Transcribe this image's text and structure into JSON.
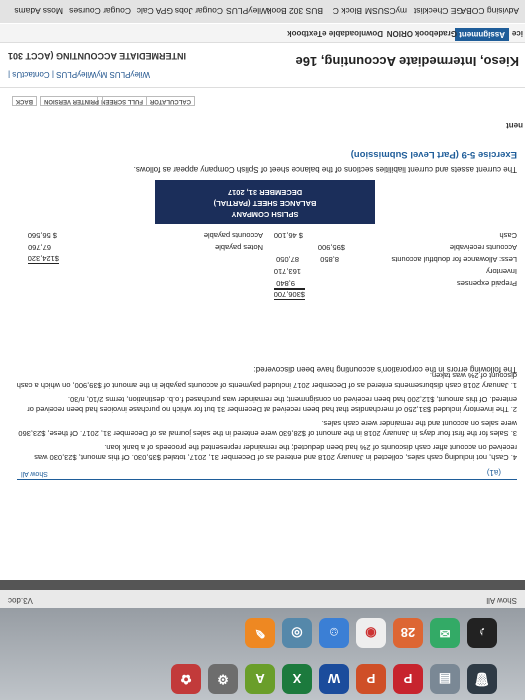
{
  "bookmarks": [
    "Advising COBA",
    "GE Checklist",
    "myCSUSM",
    "Block C",
    "BUS 302 Book",
    "WileyPLUS",
    "Cougar Jobs",
    "GPA Calc",
    "Cougar Courses",
    "Moss Adams"
  ],
  "header": {
    "course_title": "Kieso, Intermediate Accounting, 16e",
    "wp_links": "WileyPLUS  MyWileyPLUS | ContactUs |",
    "course_name": "INTERMEDIATE ACCOUNTING (ACCT 301",
    "tabs": [
      "ice",
      "Assignment",
      "Gradebook",
      "ORION",
      "Downloadable eTextbook"
    ],
    "side_label": "nent"
  },
  "tools": [
    "CALCULATOR",
    "FULL SCREEN",
    "PRINTER VERSION",
    "BACK"
  ],
  "exercise": {
    "title": "Exercise 5-9 (Part Level Submission)",
    "intro": "The current assets and current liabilities sections of the balance sheet of Splish Company appear as follows.",
    "company": "SPLISH COMPANY",
    "statement": "BALANCE SHEET (PARTIAL)",
    "date": "DECEMBER 31, 2017",
    "rows": [
      {
        "label": "Cash",
        "a": "",
        "b": "$ 46,100",
        "c": "Accounts payable",
        "d": "$ 56,560"
      },
      {
        "label": "Accounts receivable",
        "a": "$95,900",
        "b": "",
        "c": "Notes payable",
        "d": "67,760"
      },
      {
        "label": "Less: Allowance for doubtful accounts",
        "a": "8,850",
        "b": "87,050",
        "c": "",
        "d": "$124,320"
      },
      {
        "label": "Inventory",
        "a": "",
        "b": "163,710",
        "c": "",
        "d": ""
      },
      {
        "label": "Prepaid expenses",
        "a": "",
        "b": "9,840",
        "c": "",
        "d": ""
      },
      {
        "label": "",
        "a": "",
        "b": "$306,700",
        "c": "",
        "d": ""
      }
    ],
    "errors_intro": "The following errors in the corporation's accounting have been discovered:",
    "errors": [
      "1.  January 2018 cash disbursements entered as of December 2017 included payments of accounts payable in the amount of $39,900, on which a cash discount of 2% was taken.",
      "2.  The inventory included $31,250 of merchandise that had been received at December 31 but for which no purchase invoices had been received or entered. Of this amount, $12,200 had been received on consignment; the remainder was purchased f.o.b. destination, terms 2/10, n/30.",
      "3.  Sales for the first four days in January 2018 in the amount of $28,630 were entered in the sales journal as of December 31, 2017. Of these, $23,360 were sales on account and the remainder were cash sales.",
      "4.  Cash, not including cash sales, collected in January 2018 and entered as of December 31, 2017, totaled $35,030. Of this amount, $23,030 was received on account after cash discounts of 2% had been deducted; the remainder represented the proceeds of a bank loan."
    ],
    "part": "(a1)",
    "show_all": "Show All"
  },
  "download": {
    "file": "V3.doc",
    "show": "Show All"
  }
}
